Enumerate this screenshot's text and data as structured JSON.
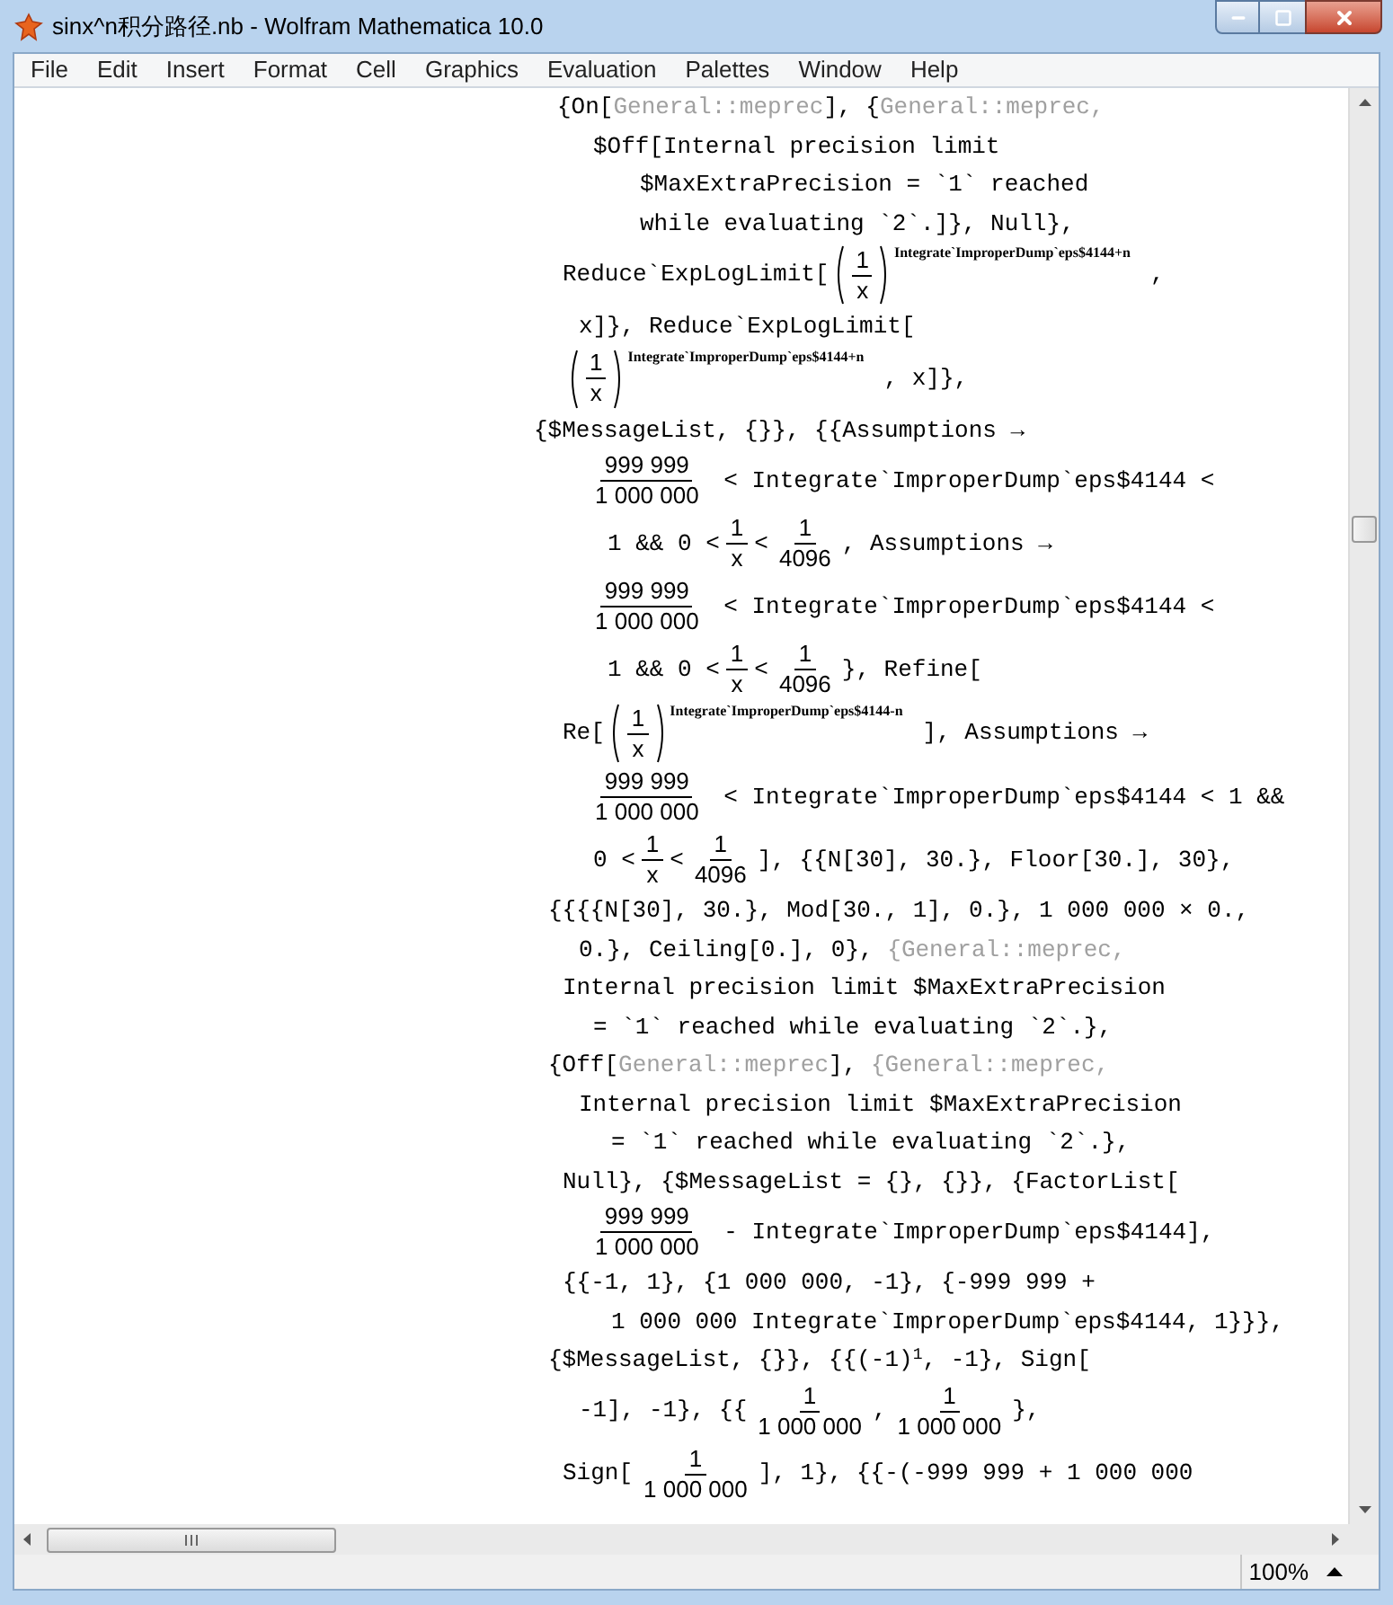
{
  "window": {
    "title": "sinx^n积分路径.nb - Wolfram Mathematica 10.0"
  },
  "menu": [
    "File",
    "Edit",
    "Insert",
    "Format",
    "Cell",
    "Graphics",
    "Evaluation",
    "Palettes",
    "Window",
    "Help"
  ],
  "notebook": {
    "lines": [
      {
        "segments": [
          {
            "kind": "text",
            "text": "{On["
          },
          {
            "kind": "muted",
            "text": "General::meprec"
          },
          {
            "kind": "text",
            "text": "], {"
          },
          {
            "kind": "muted",
            "text": "General::meprec,"
          }
        ]
      },
      {
        "segments": [
          {
            "kind": "text",
            "text": "$Off[Internal precision limit"
          }
        ]
      },
      {
        "segments": [
          {
            "kind": "text",
            "text": "$MaxExtraPrecision = `1` reached"
          }
        ]
      },
      {
        "segments": [
          {
            "kind": "text",
            "text": "while evaluating `2`.]}, Null},"
          }
        ]
      },
      {
        "segments": [
          {
            "kind": "text",
            "text": "Reduce`ExpLogLimit["
          },
          {
            "kind": "pow",
            "numerator": "1",
            "denominator": "x",
            "exponent": "Integrate`ImproperDump`eps$4144+n"
          },
          {
            "kind": "text",
            "text": ","
          }
        ]
      },
      {
        "segments": [
          {
            "kind": "text",
            "text": "x]}, Reduce`ExpLogLimit["
          }
        ]
      },
      {
        "segments": [
          {
            "kind": "pow",
            "numerator": "1",
            "denominator": "x",
            "exponent": "Integrate`ImproperDump`eps$4144+n"
          },
          {
            "kind": "text",
            "text": ", x]},"
          }
        ]
      },
      {
        "segments": [
          {
            "kind": "text",
            "text": "{$MessageList, {}}, {{Assumptions →"
          }
        ]
      },
      {
        "segments": [
          {
            "kind": "frac",
            "numerator": "999 999",
            "denominator": "1 000 000"
          },
          {
            "kind": "text",
            "text": " < Integrate`ImproperDump`eps$4144 <"
          }
        ]
      },
      {
        "segments": [
          {
            "kind": "text",
            "text": "1 && 0 <"
          },
          {
            "kind": "frac",
            "numerator": "1",
            "denominator": "x"
          },
          {
            "kind": "text",
            "text": "<"
          },
          {
            "kind": "frac",
            "numerator": "1",
            "denominator": "4096"
          },
          {
            "kind": "text",
            "text": ", Assumptions →"
          }
        ]
      },
      {
        "segments": [
          {
            "kind": "frac",
            "numerator": "999 999",
            "denominator": "1 000 000"
          },
          {
            "kind": "text",
            "text": " < Integrate`ImproperDump`eps$4144 <"
          }
        ]
      },
      {
        "segments": [
          {
            "kind": "text",
            "text": "1 && 0 <"
          },
          {
            "kind": "frac",
            "numerator": "1",
            "denominator": "x"
          },
          {
            "kind": "text",
            "text": "<"
          },
          {
            "kind": "frac",
            "numerator": "1",
            "denominator": "4096"
          },
          {
            "kind": "text",
            "text": "}, Refine["
          }
        ]
      },
      {
        "segments": [
          {
            "kind": "text",
            "text": "Re["
          },
          {
            "kind": "pow",
            "numerator": "1",
            "denominator": "x",
            "exponent": "Integrate`ImproperDump`eps$4144-n"
          },
          {
            "kind": "text",
            "text": "], Assumptions →"
          }
        ]
      },
      {
        "segments": [
          {
            "kind": "frac",
            "numerator": "999 999",
            "denominator": "1 000 000"
          },
          {
            "kind": "text",
            "text": " < Integrate`ImproperDump`eps$4144 < 1 &&"
          }
        ]
      },
      {
        "segments": [
          {
            "kind": "text",
            "text": "0 <"
          },
          {
            "kind": "frac",
            "numerator": "1",
            "denominator": "x"
          },
          {
            "kind": "text",
            "text": "<"
          },
          {
            "kind": "frac",
            "numerator": "1",
            "denominator": "4096"
          },
          {
            "kind": "text",
            "text": "], {{N[30], 30.}, Floor[30.], 30},"
          }
        ]
      },
      {
        "segments": [
          {
            "kind": "text",
            "text": "{{{{N[30], 30.}, Mod[30., 1], 0.}, 1 000 000 × 0.,"
          }
        ]
      },
      {
        "segments": [
          {
            "kind": "text",
            "text": "0.}, Ceiling[0.], 0}, "
          },
          {
            "kind": "muted",
            "text": "{General::meprec,"
          }
        ]
      },
      {
        "segments": [
          {
            "kind": "text",
            "text": "Internal precision limit $MaxExtraPrecision"
          }
        ]
      },
      {
        "segments": [
          {
            "kind": "text",
            "text": "= `1` reached while evaluating `2`.},"
          }
        ]
      },
      {
        "segments": [
          {
            "kind": "text",
            "text": "{Off["
          },
          {
            "kind": "muted",
            "text": "General::meprec"
          },
          {
            "kind": "text",
            "text": "], "
          },
          {
            "kind": "muted",
            "text": "{General::meprec,"
          }
        ]
      },
      {
        "segments": [
          {
            "kind": "text",
            "text": "Internal precision limit $MaxExtraPrecision"
          }
        ]
      },
      {
        "segments": [
          {
            "kind": "text",
            "text": "= `1` reached while evaluating `2`.},"
          }
        ]
      },
      {
        "segments": [
          {
            "kind": "text",
            "text": "Null}, {$MessageList = {}, {}}, {FactorList["
          }
        ]
      },
      {
        "segments": [
          {
            "kind": "frac",
            "numerator": "999 999",
            "denominator": "1 000 000"
          },
          {
            "kind": "text",
            "text": " - Integrate`ImproperDump`eps$4144],"
          }
        ]
      },
      {
        "segments": [
          {
            "kind": "text",
            "text": "{{-1, 1}, {1 000 000, -1}, {-999 999 +"
          }
        ]
      },
      {
        "segments": [
          {
            "kind": "text",
            "text": "1 000 000 Integrate`ImproperDump`eps$4144, 1}}},"
          }
        ]
      },
      {
        "segments": [
          {
            "kind": "text",
            "text": "{$MessageList, {}}, {{(-1)"
          },
          {
            "kind": "sup",
            "text": "1"
          },
          {
            "kind": "text",
            "text": ", -1}, Sign["
          }
        ]
      },
      {
        "segments": [
          {
            "kind": "text",
            "text": "-1], -1}, {{"
          },
          {
            "kind": "frac",
            "numerator": "1",
            "denominator": "1 000 000"
          },
          {
            "kind": "text",
            "text": ","
          },
          {
            "kind": "frac",
            "numerator": "1",
            "denominator": "1 000 000"
          },
          {
            "kind": "text",
            "text": "},"
          }
        ]
      },
      {
        "segments": [
          {
            "kind": "text",
            "text": "Sign["
          },
          {
            "kind": "frac",
            "numerator": "1",
            "denominator": "1 000 000"
          },
          {
            "kind": "text",
            "text": "], 1}, {{-(-999 999 + 1 000 000"
          }
        ]
      }
    ]
  },
  "status_bar": {
    "zoom": "100%"
  }
}
